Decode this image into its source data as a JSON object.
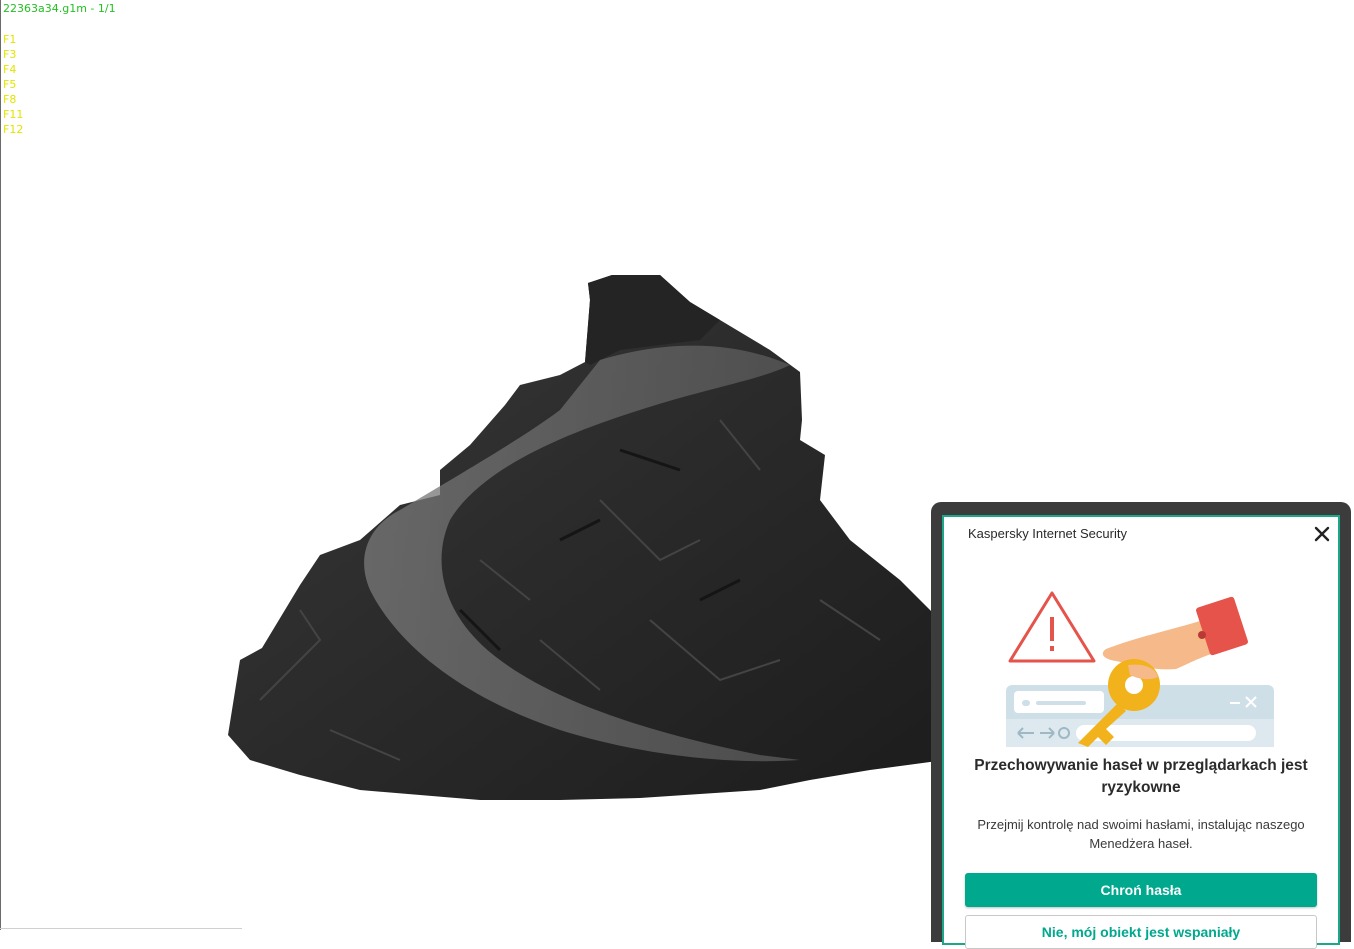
{
  "viewer": {
    "title": "22363a34.g1m - 1/1",
    "keys": [
      "F1",
      "F3",
      "F4",
      "F5",
      "F8",
      "F11",
      "F12"
    ]
  },
  "popup": {
    "app_name": "Kaspersky Internet Security",
    "close_icon": "close-icon",
    "heading": "Przechowywanie haseł w przeglądarkach jest ryzykowne",
    "body": "Przejmij kontrolę nad swoimi hasłami, instalując naszego Menedżera haseł.",
    "primary_button": "Chroń hasła",
    "secondary_button": "Nie, mój obiekt jest wspaniały",
    "accent_color": "#00a88e"
  }
}
